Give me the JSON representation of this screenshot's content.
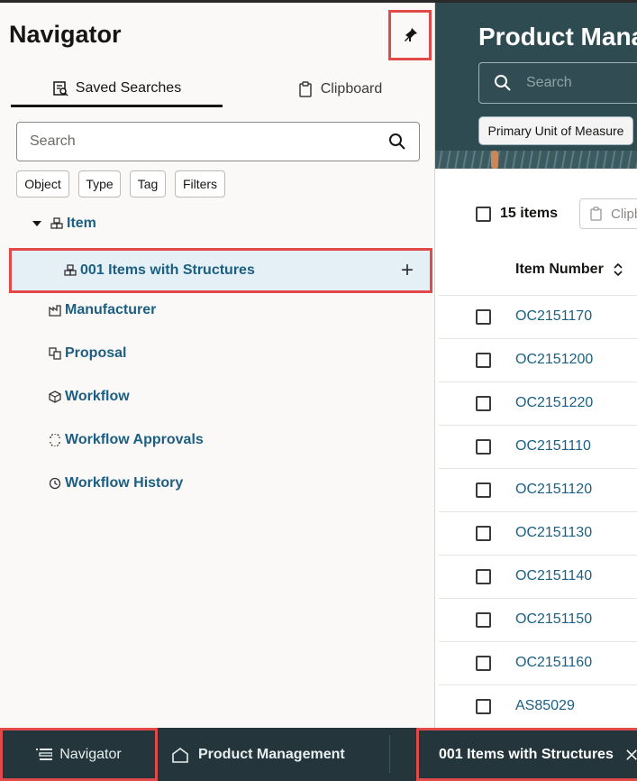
{
  "navigator": {
    "title": "Navigator",
    "tabs": [
      {
        "label": "Saved Searches"
      },
      {
        "label": "Clipboard"
      }
    ],
    "search": {
      "placeholder": "Search"
    },
    "chips": [
      "Object",
      "Type",
      "Tag",
      "Filters"
    ],
    "tree": {
      "item": "Item",
      "selected_child": "001 Items with Structures",
      "others": [
        "Manufacturer",
        "Proposal",
        "Workflow",
        "Workflow Approvals",
        "Workflow History"
      ]
    }
  },
  "main": {
    "title": "Product Mana",
    "search_placeholder": "Search",
    "uom_chip": "Primary Unit of Measure",
    "items_count": "15 items",
    "clipboard_button": "Clipb",
    "column_header": "Item Number",
    "rows": [
      "OC2151170",
      "OC2151200",
      "OC2151220",
      "OC2151110",
      "OC2151120",
      "OC2151130",
      "OC2151140",
      "OC2151150",
      "OC2151160",
      "AS85029"
    ]
  },
  "bottom_bar": {
    "navigator_label": "Navigator",
    "product_management_label": "Product Management",
    "tab_label": "001 Items with Structures"
  },
  "colors": {
    "accent_highlight": "#e24a4a",
    "link": "#1c5f82",
    "header_bg": "#2f4b52",
    "bottom_bar_bg": "#24363c",
    "selected_row_bg": "#e4f0f6"
  }
}
